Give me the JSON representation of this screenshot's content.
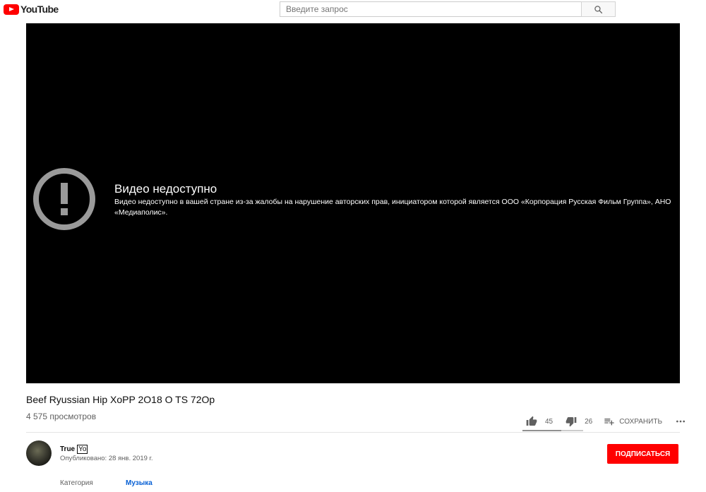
{
  "header": {
    "logo_text": "YouTube",
    "search_placeholder": "Введите запрос",
    "search_icon": "search-icon"
  },
  "player": {
    "error_icon": "alert-circle-icon",
    "error_title": "Видео недоступно",
    "error_detail": "Видео недоступно в вашей стране из-за жалобы на нарушение авторских прав, инициатором которой является ООО «Корпорация Русская Фильм Группа», АНО «Медиаполис»."
  },
  "video": {
    "title": "Beef Ryussian Hip XoPP 2O18 O TS 72Op",
    "views": "4 575 просмотров"
  },
  "actions": {
    "likes": "45",
    "dislikes": "26",
    "save_label": "СОХРАНИТЬ",
    "like_ratio": 0.634
  },
  "channel": {
    "name": "True",
    "name_tag": "Yo",
    "published": "Опубликовано: 28 янв. 2019 г.",
    "subscribe_label": "ПОДПИСАТЬСЯ"
  },
  "metadata": {
    "category_label": "Категория",
    "category_value": "Музыка"
  },
  "colors": {
    "brand_red": "#ff0000",
    "link_blue": "#065fd4",
    "player_bg": "#000000"
  }
}
